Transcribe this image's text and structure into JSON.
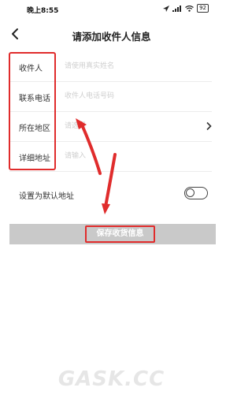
{
  "status_bar": {
    "time": "晚上8:55",
    "signal_text": "ᵢₗ",
    "battery_level": "92"
  },
  "nav": {
    "title": "请添加收件人信息"
  },
  "form": {
    "rows": [
      {
        "label": "收件人",
        "placeholder": "请使用真实姓名",
        "has_chevron": false
      },
      {
        "label": "联系电话",
        "placeholder": "收件人电话号码",
        "has_chevron": false
      },
      {
        "label": "所在地区",
        "placeholder": "请选择",
        "has_chevron": true
      },
      {
        "label": "详细地址",
        "placeholder": "请输入",
        "has_chevron": false
      }
    ]
  },
  "default_address": {
    "label": "设置为默认地址",
    "enabled": false
  },
  "save_button": {
    "label": "保存收货信息"
  },
  "annotations": {
    "highlight_color": "#e02c2c"
  },
  "watermark": {
    "text": "GASK.CC"
  },
  "icons": {
    "back": "back-arrow-icon",
    "location": "location-arrow-icon",
    "wifi": "wifi-icon",
    "signal": "signal-icon",
    "battery": "battery-icon",
    "chevron": "chevron-right-icon"
  }
}
